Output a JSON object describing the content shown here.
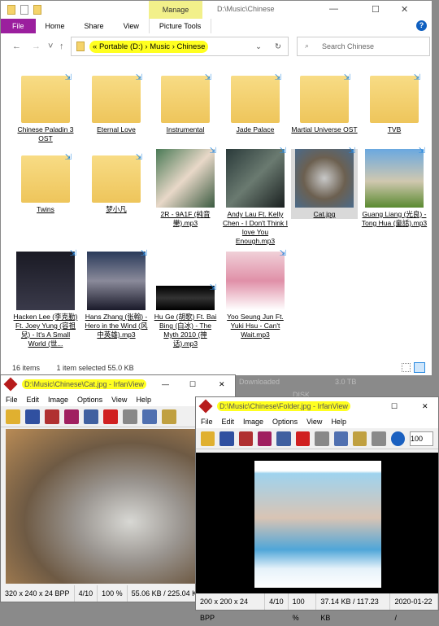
{
  "explorer": {
    "title": "D:\\Music\\Chinese",
    "manage": "Manage",
    "tabs": [
      "File",
      "Home",
      "Share",
      "View",
      "Picture Tools"
    ],
    "breadcrumb": [
      "Portable (D:)",
      "Music",
      "Chinese"
    ],
    "search_placeholder": "Search Chinese",
    "items": [
      {
        "name": "Chinese Paladin 3 OST",
        "type": "folder"
      },
      {
        "name": "Eternal Love",
        "type": "folder"
      },
      {
        "name": "Instrumental",
        "type": "folder"
      },
      {
        "name": "Jade Palace",
        "type": "folder"
      },
      {
        "name": "Martial Universe OST",
        "type": "folder"
      },
      {
        "name": "TVB",
        "type": "folder"
      },
      {
        "name": "Twins",
        "type": "folder"
      },
      {
        "name": "梦小凡",
        "type": "folder"
      },
      {
        "name": "2R - 9A1F (純音樂).mp3",
        "type": "mp3"
      },
      {
        "name": "Andy Lau Ft. Kelly Chen - I Don't Think I love You Enough.mp3",
        "type": "mp3"
      },
      {
        "name": "Cat.jpg",
        "type": "jpg",
        "selected": true
      },
      {
        "name": "Guang Liang (光良) - Tong Hua (童話).mp3",
        "type": "mp3"
      },
      {
        "name": "Hacken Lee (李克勤) Ft. Joey Yung (容祖兒) - It's A Small World (世...",
        "type": "mp3"
      },
      {
        "name": "Hans Zhang (张翰) - Hero in the Wind (风中英雄).mp3",
        "type": "mp3"
      },
      {
        "name": "Hu Ge (胡歌) Ft. Bai Bing (白冰) - The Myth 2010 (神话).mp3",
        "type": "mp3"
      },
      {
        "name": "Yoo Seung Jun Ft. Yuki Hsu - Can't Wait.mp3",
        "type": "mp3"
      }
    ],
    "status_count": "16 items",
    "status_selected": "1 item selected  55.0 KB"
  },
  "background": {
    "downloaded": "Downloaded",
    "size": "3.0 TB",
    "disk": "DISK"
  },
  "irfan1": {
    "title": "D:\\Music\\Chinese\\Cat.jpg - IrfanView",
    "menu": [
      "File",
      "Edit",
      "Image",
      "Options",
      "View",
      "Help"
    ],
    "status": [
      "320 x 240 x 24 BPP",
      "4/10",
      "100 %",
      "55.06 KB / 225.04 KB"
    ]
  },
  "irfan2": {
    "title": "D:\\Music\\Chinese\\Folder.jpg - IrfanView",
    "menu": [
      "File",
      "Edit",
      "Image",
      "Options",
      "View",
      "Help"
    ],
    "zoom_value": "100",
    "status": [
      "200 x 200 x 24 BPP",
      "4/10",
      "100 %",
      "37.14 KB / 117.23 KB",
      "2020-01-22 /"
    ]
  },
  "colors": {
    "file_tab": "#9b1f9e",
    "manage": "#f2f08a",
    "highlight": "#ffff20"
  }
}
